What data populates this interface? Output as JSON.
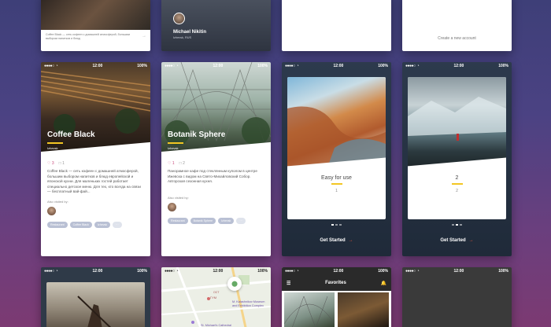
{
  "top_row": {
    "card1": {
      "text": "Coffee Black — сеть кофеен с домашней атмосферой, большим выбором напитков и блюд",
      "arrow": "→"
    },
    "card2": {
      "name": "Michael Nikitin",
      "location": "Izhevsk, RUS"
    },
    "card4": {
      "text": "Create a new account"
    }
  },
  "status": {
    "time": "12:00",
    "battery": "100%",
    "signal": "●●●●○"
  },
  "coffee": {
    "title": "Coffee Black",
    "subtitle": "Izhevsk",
    "likes": "♡ 3",
    "comments": "□ 1",
    "description": "Coffee Black — сеть кофеен с домашней атмосферой, большим выбором напитков и блюд европейской и японской кухни. Для маленьких гостей работает специально детское меню. Для тех, кто всегда на связи — бесплатный вай-фай...",
    "also": "Also visited by:",
    "tags": [
      "Restaurant",
      "Coffee Black",
      "Izhevsk",
      "···"
    ]
  },
  "botanik": {
    "title": "Botanik Sphere",
    "subtitle": "Izhevsk",
    "likes": "♡ 1",
    "comments": "□ 2",
    "description": "Панорамное кафе под стеклянным куполом в центре Ижевска с видом на Свято-Михайловский Собор. Авторская сезонная кухня.",
    "also": "Also visited by:",
    "tags": [
      "Restaurant",
      "Botanik Sphere",
      "Izhevsk",
      "···"
    ]
  },
  "onboard1": {
    "title": "Easy for use",
    "num": "1",
    "cta": "Get Started",
    "arrow": "→"
  },
  "onboard2": {
    "title": "2",
    "num": "2",
    "cta": "Get Started",
    "arrow": "→"
  },
  "favorites": {
    "title": "Favorites",
    "menu_icon": "☰",
    "bell_icon": "🔔"
  },
  "map": {
    "labels": [
      "ГУМ",
      "M. Kalashnikov Museum and Exhibition Complex",
      "St. Michael's Cathedral",
      "ОСТ"
    ]
  },
  "colors": {
    "accent": "#f3c623",
    "cta_arrow": "#e0553d"
  }
}
